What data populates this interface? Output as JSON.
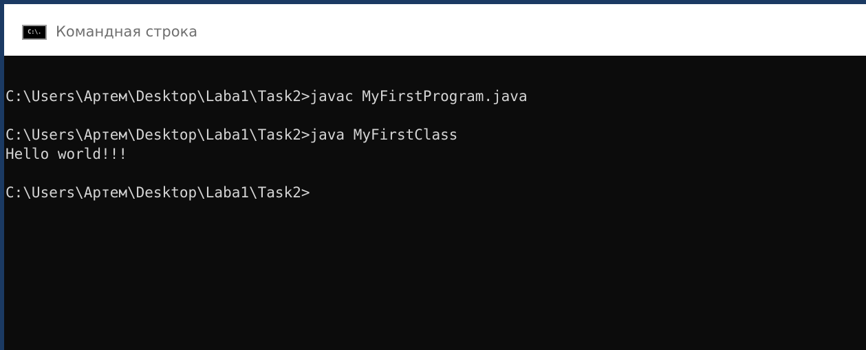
{
  "window": {
    "title": "Командная строка",
    "icon": "cmd-icon",
    "icon_text": "C:\\."
  },
  "console": {
    "lines": [
      "C:\\Users\\Артем\\Desktop\\Laba1\\Task2>javac MyFirstProgram.java",
      "",
      "C:\\Users\\Артем\\Desktop\\Laba1\\Task2>java MyFirstClass",
      "Hello world!!!",
      "",
      "C:\\Users\\Артем\\Desktop\\Laba1\\Task2>"
    ]
  },
  "colors": {
    "background": "#0c0c0c",
    "text": "#d4d4d4",
    "titlebar": "#ffffff",
    "border": "#1b3a63"
  }
}
